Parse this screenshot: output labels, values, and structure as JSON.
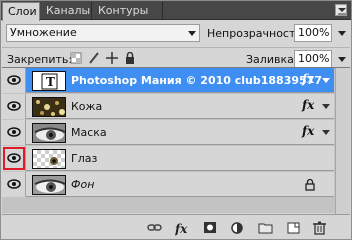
{
  "tabs": [
    {
      "label": "Слои"
    },
    {
      "label": "Каналы"
    },
    {
      "label": "Контуры"
    }
  ],
  "blend_mode": "Умножение",
  "opacity": {
    "label": "Непрозрачность:",
    "value": "100%"
  },
  "lock": {
    "label": "Закрепить:"
  },
  "fill": {
    "label": "Заливка:",
    "value": "100%"
  },
  "layers": [
    {
      "name": "Photoshop Мания © 2010 club18839577",
      "fx": "fx",
      "thumb": "text-layer-icon",
      "selected": true
    },
    {
      "name": "Кожа",
      "fx": "fx",
      "thumb": "skin-texture"
    },
    {
      "name": "Маска",
      "fx": "fx",
      "thumb": "eye-image"
    },
    {
      "name": "Глаз",
      "thumb": "transparent-eye"
    },
    {
      "name": "Фон",
      "thumb": "eye-image",
      "locked": true
    }
  ],
  "footer_icons": [
    "link-icon",
    "fx-icon",
    "mask-icon",
    "adjustment-icon",
    "folder-icon",
    "new-layer-icon",
    "trash-icon"
  ],
  "colors": {
    "selection": "#3f8ef2",
    "highlight": "#e11a2a",
    "panel": "#d6d6d6",
    "tabbar": "#474747"
  }
}
